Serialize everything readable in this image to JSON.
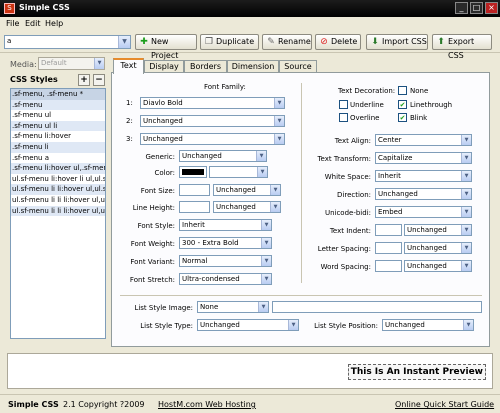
{
  "window": {
    "title": "Simple CSS",
    "app_icon": "S"
  },
  "menu": {
    "file": "File",
    "edit": "Edit",
    "help": "Help"
  },
  "toolbar": {
    "selector_value": "a",
    "new_project": "New Project",
    "duplicate": "Duplicate",
    "rename": "Rename",
    "delete": "Delete",
    "import_css": "Import CSS",
    "export_css": "Export CSS"
  },
  "left": {
    "media_label": "Media:",
    "media_value": "Default",
    "styles_title": "CSS Styles",
    "add_label": "+",
    "remove_label": "−",
    "styles": [
      ".sf-menu, .sf-menu *",
      ".sf-menu",
      ".sf-menu ul",
      ".sf-menu ul li",
      ".sf-menu li:hover",
      ".sf-menu li",
      ".sf-menu a",
      ".sf-menu li:hover ul,.sf-menu",
      "ul.sf-menu li:hover li ul,ul.sf",
      "ul.sf-menu li li:hover ul,ul.sf-m",
      "ul.sf-menu li li li:hover ul,ul.sf",
      "ul.sf-menu li li li:hover ul,ul.sf"
    ]
  },
  "tabs": [
    "Text",
    "Display",
    "Borders",
    "Dimension",
    "Source"
  ],
  "text_tab": {
    "font_family_label": "Font Family:",
    "font_rows": [
      {
        "num": "1:",
        "value": "Diavlo Bold"
      },
      {
        "num": "2:",
        "value": "Unchanged"
      },
      {
        "num": "3:",
        "value": "Unchanged"
      }
    ],
    "generic_label": "Generic:",
    "generic_value": "Unchanged",
    "color_label": "Color:",
    "font_size_label": "Font Size:",
    "font_size_value": "Unchanged",
    "line_height_label": "Line Height:",
    "line_height_value": "Unchanged",
    "font_style_label": "Font Style:",
    "font_style_value": "Inherit",
    "font_weight_label": "Font Weight:",
    "font_weight_value": "300 - Extra Bold",
    "font_variant_label": "Font Variant:",
    "font_variant_value": "Normal",
    "font_stretch_label": "Font Stretch:",
    "font_stretch_value": "Ultra-condensed",
    "decoration_label": "Text Decoration:",
    "deco_none": "None",
    "deco_underline": "Underline",
    "deco_linethrough": "Linethrough",
    "deco_overline": "Overline",
    "deco_blink": "Blink",
    "check_mark": "✔",
    "text_align_label": "Text Align:",
    "text_align_value": "Center",
    "text_transform_label": "Text Transform:",
    "text_transform_value": "Capitalize",
    "white_space_label": "White Space:",
    "white_space_value": "Inherit",
    "direction_label": "Direction:",
    "direction_value": "Unchanged",
    "unicode_bidi_label": "Unicode-bidi:",
    "unicode_bidi_value": "Embed",
    "text_indent_label": "Text Indent:",
    "text_indent_value": "Unchanged",
    "letter_spacing_label": "Letter Spacing:",
    "letter_spacing_value": "Unchanged",
    "word_spacing_label": "Word Spacing:",
    "word_spacing_value": "Unchanged",
    "list_image_label": "List Style Image:",
    "list_image_value": "None",
    "list_type_label": "List Style Type:",
    "list_type_value": "Unchanged",
    "list_position_label": "List Style Position:",
    "list_position_value": "Unchanged"
  },
  "preview": {
    "text": "This Is An Instant Preview"
  },
  "status": {
    "product": "Simple CSS",
    "copyright": "2.1 Copyright ?2009",
    "hosting_link": "HostM.com Web Hosting",
    "guide_link": "Online Quick Start Guide"
  },
  "colors": {
    "accent_tab": "#e68b2c",
    "color_swatch": "#000000"
  }
}
